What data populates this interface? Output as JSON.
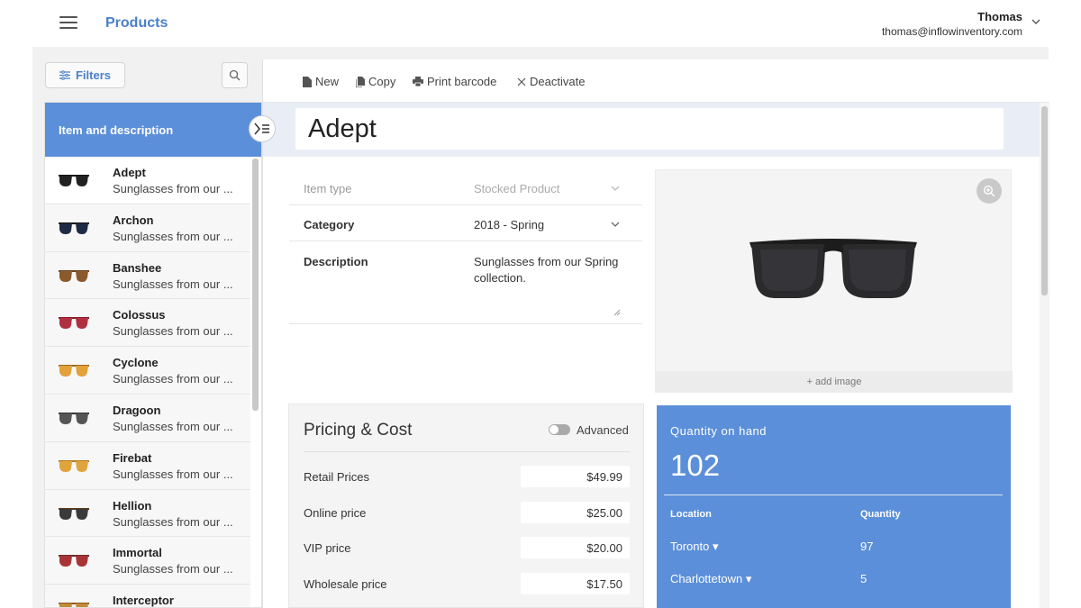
{
  "header": {
    "title": "Products",
    "user_name": "Thomas",
    "user_email": "thomas@inflowinventory.com"
  },
  "sidebar": {
    "filters_label": "Filters",
    "list_header": "Item and description",
    "items": [
      {
        "name": "Adept",
        "desc": "Sunglasses from our ...",
        "lens": "#222222",
        "frame": "#111111"
      },
      {
        "name": "Archon",
        "desc": "Sunglasses from our ...",
        "lens": "#1f2a44",
        "frame": "#101010"
      },
      {
        "name": "Banshee",
        "desc": "Sunglasses from our ...",
        "lens": "#8a5a2b",
        "frame": "#6b4423"
      },
      {
        "name": "Colossus",
        "desc": "Sunglasses from our ...",
        "lens": "#b03040",
        "frame": "#8b1a2b"
      },
      {
        "name": "Cyclone",
        "desc": "Sunglasses from our ...",
        "lens": "#e2a13a",
        "frame": "#9c6a1c"
      },
      {
        "name": "Dragoon",
        "desc": "Sunglasses from our ...",
        "lens": "#555555",
        "frame": "#333333"
      },
      {
        "name": "Firebat",
        "desc": "Sunglasses from our ...",
        "lens": "#e0a43c",
        "frame": "#b07a22"
      },
      {
        "name": "Hellion",
        "desc": "Sunglasses from our ...",
        "lens": "#3a3a3a",
        "frame": "#5a3a1a"
      },
      {
        "name": "Immortal",
        "desc": "Sunglasses from our ...",
        "lens": "#a83535",
        "frame": "#6b2a2a"
      },
      {
        "name": "Interceptor",
        "desc": "",
        "lens": "#c48a3a",
        "frame": "#8a5a20"
      }
    ]
  },
  "toolbar": {
    "new_label": "New",
    "copy_label": "Copy",
    "print_label": "Print barcode",
    "deactivate_label": "Deactivate"
  },
  "product": {
    "name": "Adept",
    "item_type_label": "Item type",
    "item_type_value": "Stocked Product",
    "category_label": "Category",
    "category_value": "2018 - Spring",
    "description_label": "Description",
    "description_value": "Sunglasses from our Spring collection.",
    "add_image_label": "+ add image"
  },
  "pricing": {
    "title": "Pricing & Cost",
    "advanced_label": "Advanced",
    "rows": [
      {
        "label": "Retail Prices",
        "value": "$49.99"
      },
      {
        "label": "Online price",
        "value": "$25.00"
      },
      {
        "label": "VIP price",
        "value": "$20.00"
      },
      {
        "label": "Wholesale price",
        "value": "$17.50"
      }
    ]
  },
  "quantity": {
    "label": "Quantity on hand",
    "total": "102",
    "location_header": "Location",
    "quantity_header": "Quantity",
    "rows": [
      {
        "location": "Toronto ▾",
        "quantity": "97"
      },
      {
        "location": "Charlottetown ▾",
        "quantity": "5"
      }
    ]
  },
  "colors": {
    "accent": "#5b8fd9",
    "title_blue": "#4a7fc9"
  }
}
